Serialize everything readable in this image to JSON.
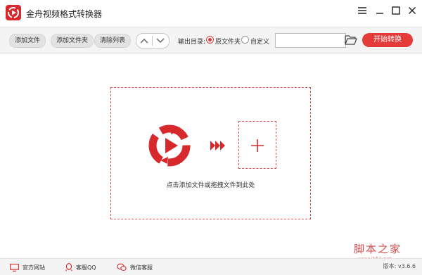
{
  "window": {
    "title": "金舟视频格式转换器",
    "icons": [
      "menu-icon",
      "minimize-icon",
      "maximize-icon",
      "close-icon"
    ]
  },
  "toolbar": {
    "add_file": "添加文件",
    "add_folder": "添加文件夹",
    "clear_list": "清除列表",
    "output_label": "输出目录:",
    "output_options": [
      {
        "label": "原文件夹",
        "selected": true
      },
      {
        "label": "自定义",
        "selected": false
      }
    ],
    "output_path": "",
    "start_button": "开始转换"
  },
  "drop_zone": {
    "hint": "点击添加文件或拖拽文件到此处"
  },
  "watermark": {
    "text": "脚本之家",
    "url": "www.jb51.net"
  },
  "statusbar": {
    "website": "官方网站",
    "qq": "客服QQ",
    "wechat": "微信客服",
    "version": "版本: v3.6.6"
  },
  "colors": {
    "accent": "#e43b3b",
    "dashed_border": "#e04a4a"
  }
}
